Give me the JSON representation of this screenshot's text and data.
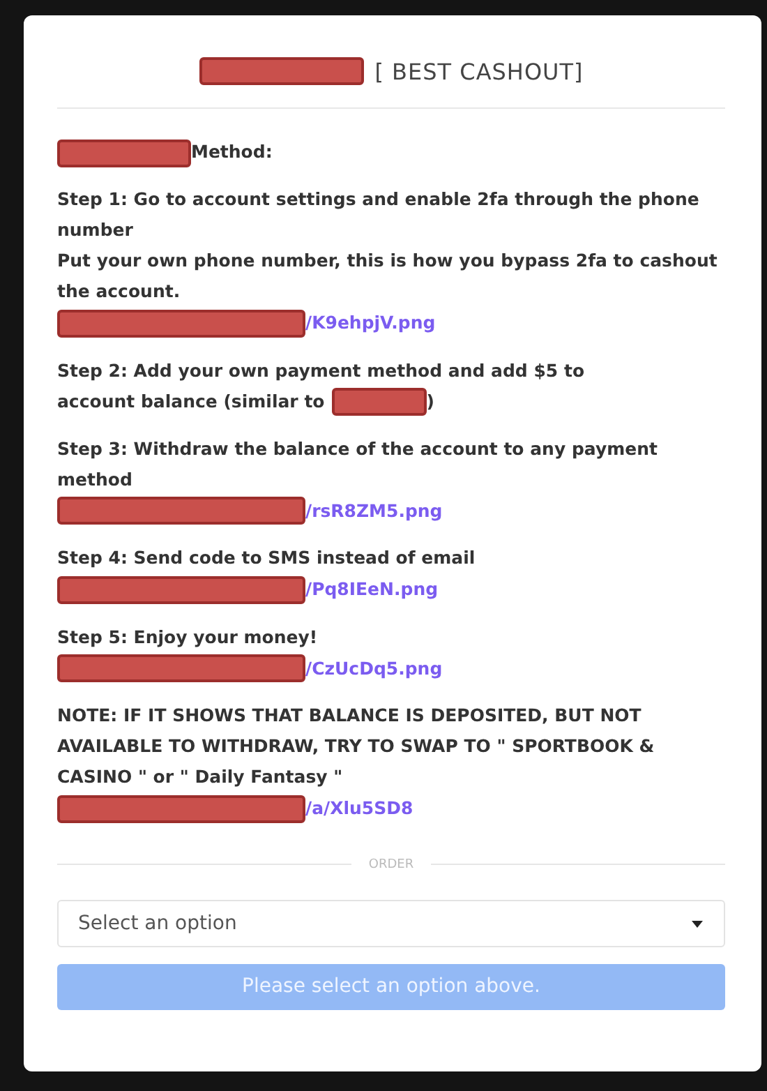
{
  "title": {
    "segments": [
      {
        "kind": "redacted"
      },
      {
        "kind": "text",
        "text": "[ BEST CASHOUT]"
      }
    ]
  },
  "paragraphs": [
    {
      "lines": [
        [
          {
            "kind": "redacted"
          },
          {
            "kind": "text",
            "text": "Method:"
          }
        ]
      ]
    },
    {
      "lines": [
        [
          {
            "kind": "text",
            "text": "Step 1: Go to account settings and enable 2fa through the phone number"
          }
        ],
        [
          {
            "kind": "text",
            "text": "Put your own phone number, this is how you bypass 2fa to cashout the account."
          }
        ],
        [
          {
            "kind": "redacted"
          },
          {
            "kind": "link",
            "text": "/K9ehpjV.png"
          }
        ]
      ]
    },
    {
      "lines": [
        [
          {
            "kind": "text",
            "text": "Step 2: Add your own payment method and add $5 to"
          }
        ],
        [
          {
            "kind": "text",
            "text": "account balance (similar to"
          },
          {
            "kind": "redacted"
          },
          {
            "kind": "text",
            "text": ")"
          }
        ]
      ]
    },
    {
      "lines": [
        [
          {
            "kind": "text",
            "text": "Step 3: Withdraw the balance of the account to any payment method"
          }
        ],
        [
          {
            "kind": "redacted"
          },
          {
            "kind": "link",
            "text": "/rsR8ZM5.png"
          }
        ]
      ]
    },
    {
      "lines": [
        [
          {
            "kind": "text",
            "text": "Step 4: Send code to SMS instead of email"
          }
        ],
        [
          {
            "kind": "redacted"
          },
          {
            "kind": "link",
            "text": "/Pq8IEeN.png"
          }
        ]
      ]
    },
    {
      "lines": [
        [
          {
            "kind": "text",
            "text": "Step 5: Enjoy your money!"
          }
        ],
        [
          {
            "kind": "redacted"
          },
          {
            "kind": "link",
            "text": "/CzUcDq5.png"
          }
        ]
      ]
    },
    {
      "lines": [
        [
          {
            "kind": "text",
            "text": "NOTE: IF IT SHOWS THAT BALANCE IS DEPOSITED, BUT NOT AVAILABLE TO WITHDRAW, TRY TO SWAP TO \" SPORTBOOK & CASINO \" or \" Daily Fantasy \""
          }
        ],
        [
          {
            "kind": "redacted"
          },
          {
            "kind": "link",
            "text": "/a/Xlu5SD8"
          }
        ]
      ]
    }
  ],
  "divider": {
    "label": "ORDER"
  },
  "select": {
    "placeholder": "Select an option"
  },
  "submit": {
    "label": "Please select an option above.",
    "disabled": true
  }
}
